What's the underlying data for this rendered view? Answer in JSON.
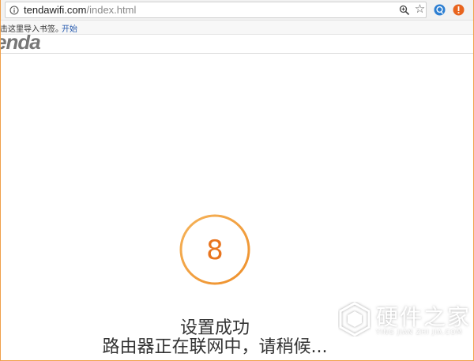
{
  "browser": {
    "url_domain": "tendawifi.com",
    "url_path": "/index.html",
    "icons": {
      "info": "info-icon",
      "zoom": "zoom-icon",
      "bookmark": "star-icon",
      "extension_1": "extension-icon",
      "extension_2": "extension-icon"
    }
  },
  "bookmarks_bar": {
    "hint": "击这里导入书签。",
    "link": "开始"
  },
  "header": {
    "logo_text": "enda"
  },
  "countdown": {
    "value": "8",
    "color": "#e8741e",
    "ring_color": "#f0a030"
  },
  "status": {
    "title": "设置成功",
    "message": "路由器正在联网中，请稍候..."
  },
  "watermark": {
    "text_cn": "硬件之家",
    "text_en": "YING JIAN ZHI JIA.COM"
  }
}
